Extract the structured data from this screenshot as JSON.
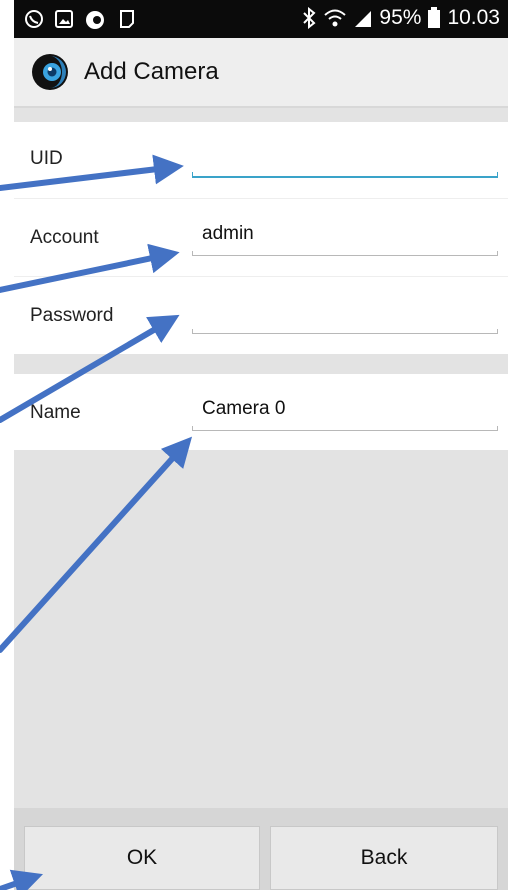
{
  "status_bar": {
    "left_icons": [
      "phone-call-icon",
      "image-icon",
      "camera-app-icon",
      "notification-icon"
    ],
    "right_icons": [
      "bluetooth-icon",
      "wifi-icon",
      "signal-icon",
      "battery-icon"
    ],
    "battery": "95%",
    "time": "10.03"
  },
  "app_bar": {
    "title": "Add Camera"
  },
  "form": {
    "uid": {
      "label": "UID",
      "value": ""
    },
    "account": {
      "label": "Account",
      "value": "admin"
    },
    "password": {
      "label": "Password",
      "value": ""
    },
    "name": {
      "label": "Name",
      "value": "Camera 0"
    }
  },
  "buttons": {
    "ok": "OK",
    "back": "Back"
  },
  "colors": {
    "accent": "#3aa3c9",
    "annotation_arrow": "#4472c4"
  }
}
